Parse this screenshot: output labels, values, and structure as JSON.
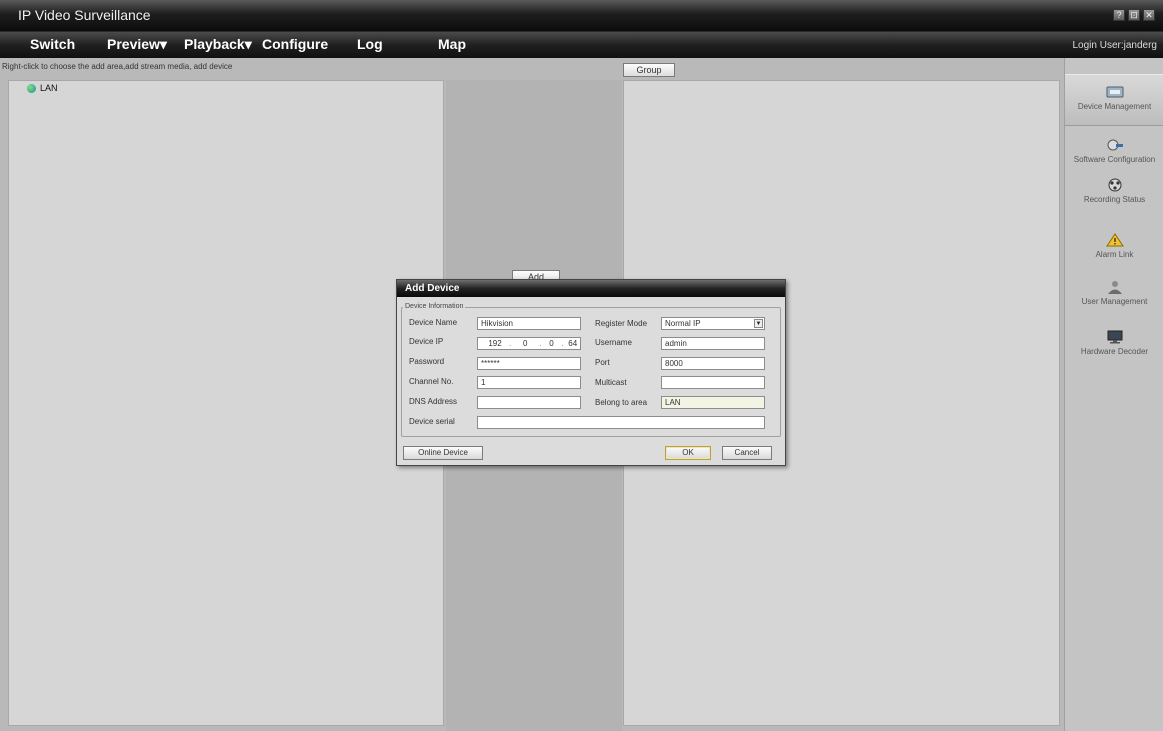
{
  "app": {
    "title": "IP Video Surveillance",
    "login_text": "Login User:janderg",
    "window_controls": [
      "?",
      "⊡",
      "✕"
    ]
  },
  "menu": {
    "items": [
      {
        "label": "Switch"
      },
      {
        "label": "Preview▾"
      },
      {
        "label": "Playback▾"
      },
      {
        "label": "Configure"
      },
      {
        "label": "Log"
      },
      {
        "label": "Map"
      }
    ]
  },
  "hint": "Right-click to choose the add area,add stream media, add device",
  "tree": {
    "items": [
      {
        "label": "LAN",
        "icon": "globe-icon"
      }
    ]
  },
  "group_button": "Group",
  "middle_button": "Add",
  "sidebar": {
    "items": [
      {
        "label": "Device Management",
        "icon": "device-icon",
        "active": true
      },
      {
        "label": "Software Configuration",
        "icon": "software-config-icon",
        "active": false
      },
      {
        "label": "Recording Status",
        "icon": "recording-icon",
        "active": false
      },
      {
        "label": "Alarm Link",
        "icon": "alarm-icon",
        "active": false
      },
      {
        "label": "User Management",
        "icon": "user-icon",
        "active": false
      },
      {
        "label": "Hardware Decoder",
        "icon": "decoder-icon",
        "active": false
      }
    ]
  },
  "dialog": {
    "title": "Add Device",
    "section_label": "Device Information",
    "labels": {
      "device_name": "Device Name",
      "device_ip": "Device IP",
      "password": "Password",
      "channel_no": "Channel No.",
      "dns_address": "DNS Address",
      "device_serial": "Device serial",
      "register_mode": "Register Mode",
      "username": "Username",
      "port": "Port",
      "multicast": "Multicast",
      "belong_to_area": "Belong to area"
    },
    "values": {
      "device_name": "Hikvision",
      "device_ip": [
        "192",
        "0",
        "0",
        "64"
      ],
      "password": "******",
      "channel_no": "1",
      "dns_address": "",
      "device_serial": "",
      "register_mode": "Normal IP",
      "username": "admin",
      "port": "8000",
      "multicast": "",
      "belong_to_area": "LAN"
    },
    "buttons": {
      "online_device": "Online Device",
      "ok": "OK",
      "cancel": "Cancel"
    }
  },
  "colors": {
    "titlebar_dark": "#0c0c0c",
    "panel_bg": "#d6d6d6",
    "app_bg": "#b9b9b9",
    "ok_border": "#b8a04a"
  }
}
